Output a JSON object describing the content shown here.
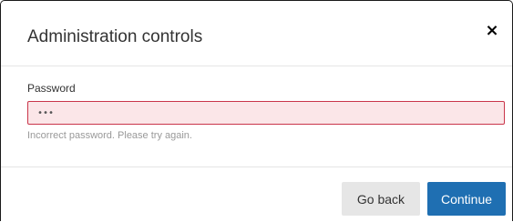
{
  "dialog": {
    "title": "Administration controls",
    "close_symbol": "×",
    "close_icon": "close-icon"
  },
  "form": {
    "password_label": "Password",
    "password_value": "•••",
    "error_message": "Incorrect password. Please try again."
  },
  "footer": {
    "back_label": "Go back",
    "continue_label": "Continue"
  },
  "colors": {
    "error_border": "#c9354a",
    "error_fill": "#fbe6e8",
    "primary": "#1f6fb2",
    "secondary": "#e6e6e6"
  }
}
